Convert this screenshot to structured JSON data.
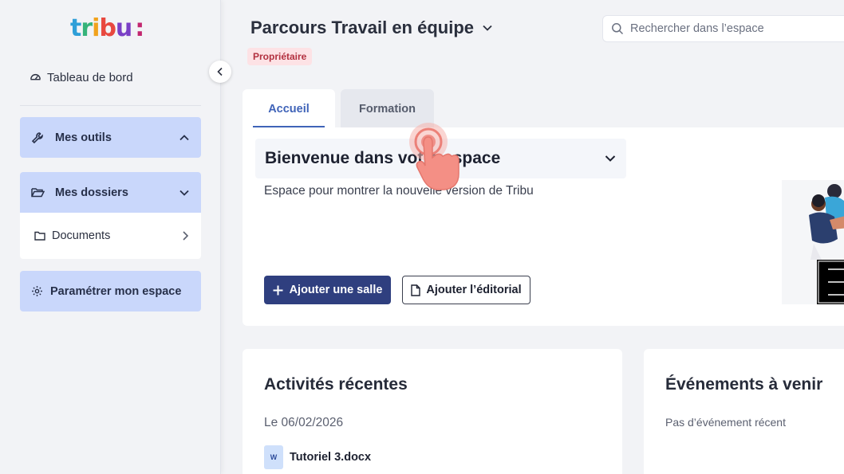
{
  "brand": {
    "logo_letters": [
      "t",
      "r",
      "i",
      "b",
      "u",
      ":"
    ],
    "logo_colors": [
      "#2f9fd8",
      "#35b37a",
      "#f1a21c",
      "#e8483f",
      "#7a3fc6",
      "#c2266f"
    ]
  },
  "sidebar": {
    "dashboard_label": "Tableau de bord",
    "tools_label": "Mes outils",
    "folders_label": "Mes dossiers",
    "documents_label": "Documents",
    "settings_label": "Paramétrer mon espace"
  },
  "header": {
    "title": "Parcours Travail en équipe",
    "role_badge": "Propriétaire",
    "search_placeholder": "Rechercher dans l’espace"
  },
  "tabs": [
    {
      "label": "Accueil",
      "active": true
    },
    {
      "label": "Formation",
      "active": false
    }
  ],
  "welcome": {
    "title": "Bienvenue dans votre espace",
    "description": "Espace pour montrer la nouvelle version de Tribu",
    "add_room_label": "Ajouter une salle",
    "add_editorial_label": "Ajouter l’éditorial"
  },
  "activities": {
    "title": "Activités récentes",
    "date": "Le 06/02/2026",
    "file_type": "W",
    "file_name": "Tutoriel 3.docx"
  },
  "events": {
    "title": "Événements à venir",
    "empty": "Pas d’événement récent"
  },
  "colors": {
    "accent": "#3f63b8",
    "nav_bg": "#c9d7fb",
    "primary_btn": "#2f3f7f",
    "badge_bg": "#fde2e5",
    "badge_text": "#b2303f"
  }
}
